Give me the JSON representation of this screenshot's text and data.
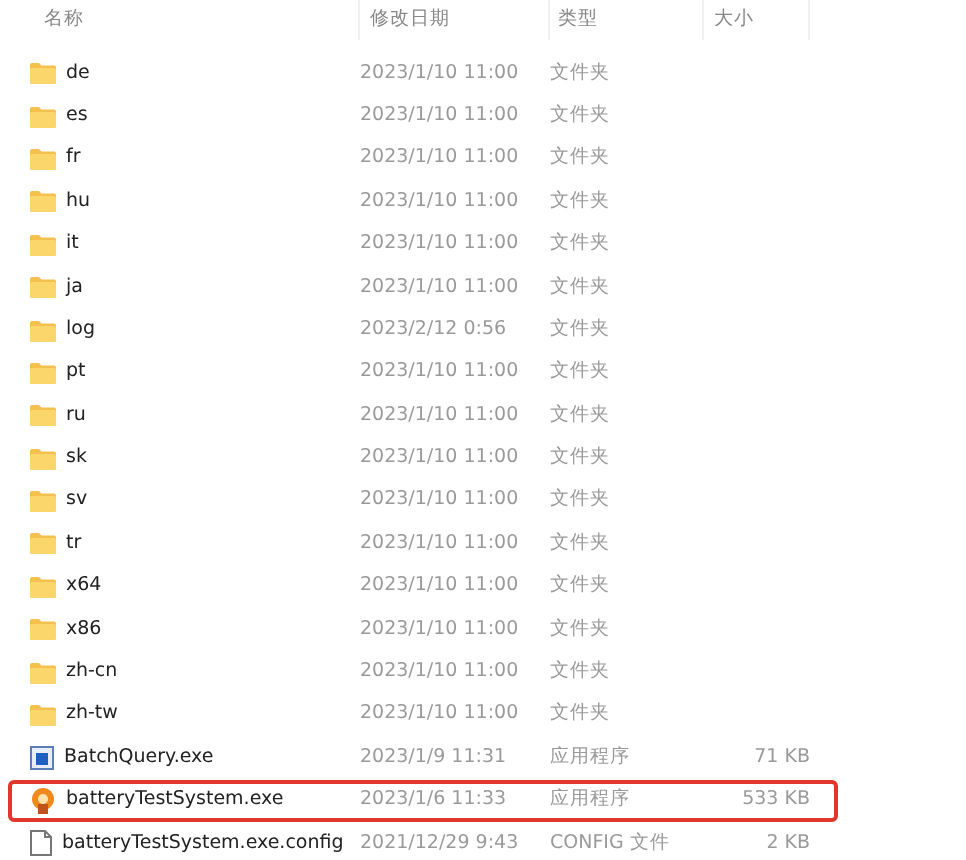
{
  "columns": [
    "名称",
    "修改日期",
    "类型",
    "大小"
  ],
  "rows": [
    {
      "kind": "folder",
      "name": "de",
      "date": "2023/1/10 11:00",
      "type": "文件夹",
      "highlighted": false
    },
    {
      "kind": "folder",
      "name": "es",
      "date": "2023/1/10 11:00",
      "type": "文件夹",
      "highlighted": false
    },
    {
      "kind": "folder",
      "name": "fr",
      "date": "2023/1/10 11:00",
      "type": "文件夹",
      "highlighted": false
    },
    {
      "kind": "folder",
      "name": "hu",
      "date": "2023/1/10 11:00",
      "type": "文件夹",
      "highlighted": false
    },
    {
      "kind": "folder",
      "name": "it",
      "date": "2023/1/10 11:00",
      "type": "文件夹",
      "highlighted": false
    },
    {
      "kind": "folder",
      "name": "ja",
      "date": "2023/1/10 11:00",
      "type": "文件夹",
      "highlighted": false
    },
    {
      "kind": "folder",
      "name": "log",
      "date": "2023/2/12 0:56",
      "type": "文件夹",
      "highlighted": false
    },
    {
      "kind": "folder",
      "name": "pt",
      "date": "2023/1/10 11:00",
      "type": "文件夹",
      "highlighted": false
    },
    {
      "kind": "folder",
      "name": "ru",
      "date": "2023/1/10 11:00",
      "type": "文件夹",
      "highlighted": false
    },
    {
      "kind": "folder",
      "name": "sk",
      "date": "2023/1/10 11:00",
      "type": "文件夹",
      "highlighted": false
    },
    {
      "kind": "folder",
      "name": "sv",
      "date": "2023/1/10 11:00",
      "type": "文件夹",
      "highlighted": false
    },
    {
      "kind": "folder",
      "name": "tr",
      "date": "2023/1/10 11:00",
      "type": "文件夹",
      "highlighted": false
    },
    {
      "kind": "folder",
      "name": "x64",
      "date": "2023/1/10 11:00",
      "type": "文件夹",
      "highlighted": false
    },
    {
      "kind": "folder",
      "name": "x86",
      "date": "2023/1/10 11:00",
      "type": "文件夹",
      "highlighted": false
    },
    {
      "kind": "folder",
      "name": "zh-cn",
      "date": "2023/1/10 11:00",
      "type": "文件夹",
      "highlighted": false
    },
    {
      "kind": "folder",
      "name": "zh-tw",
      "date": "2023/1/10 11:00",
      "type": "文件夹",
      "highlighted": false
    },
    {
      "kind": "window-exe",
      "name": "BatchQuery.exe",
      "date": "2023/1/9 11:31",
      "type": "应用程序",
      "size": "71 KB",
      "highlighted": false
    },
    {
      "kind": "app-exe",
      "name": "batteryTestSystem.exe",
      "date": "2023/1/6 11:33",
      "type": "应用程序",
      "size": "533 KB",
      "highlighted": true
    },
    {
      "kind": "file",
      "name": "batteryTestSystem.exe.config",
      "date": "2021/12/29 9:43",
      "type": "CONFIG 文件",
      "size": "2 KB",
      "highlighted": false
    }
  ]
}
